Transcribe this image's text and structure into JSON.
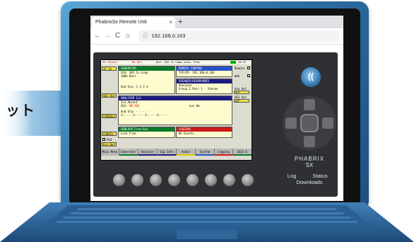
{
  "banner_text": "ット",
  "browser": {
    "tab_title": "PhabrixSx Remote Unit",
    "tab_close": "×",
    "new_tab": "+",
    "back": "←",
    "forward": "→",
    "reload": "C",
    "home": "⌂",
    "info_icon": "ⓘ",
    "url": "192.168.0.163"
  },
  "device": {
    "status_bar": {
      "in_label": "In:",
      "in_value": "Absent",
      "aes_value": "NO AES",
      "output": "Out: SDI In Loop  Lock:   Free",
      "time": "10:47"
    },
    "left_buttons": [
      "1F In",
      "SDI Out",
      "CVBSOut",
      "CVBSIn",
      "Ext.Ref"
    ],
    "psu_label": "PSU",
    "generator": {
      "title": "GENERATOR",
      "line1": "Std: SDI In Loop",
      "line2": "100% Bars",
      "line3": "Aud Grp:  1 2 3 4"
    },
    "remote_control": {
      "title": "REMOTE CONTROL",
      "line1": "TCP/IP: 192.168.0.163"
    },
    "speaker": {
      "title": "SPEAKER/HEADPHONES",
      "line1": "Analyser",
      "line2": "Group 1 Pair 1 - Stereo"
    },
    "right_labels": {
      "remote": "Remote",
      "web": "Web",
      "ana_out": "Ana Out",
      "ana_out_value": "OFF",
      "aes_out": "AES Out",
      "aes_out_value": "OFF"
    },
    "analyser": {
      "title": "ANALYSER    In1",
      "line1": "In1 Absent",
      "line2_label": "AES:",
      "line2_value": "NO AES",
      "len": "Len 0m",
      "line3": "Aud Grp:  - - - -",
      "line4": "1:----  2:----  3:----  4:----"
    },
    "genlock": {
      "title": "GENLOCK    Free-Run",
      "line1": "Lock   Free"
    },
    "logging": {
      "title": "LOGGING",
      "line1": "No Events"
    },
    "menu": [
      "Main Menu",
      "Generator",
      "Analyser",
      "Sig Info",
      "Audio",
      "System",
      "Logging",
      "2022-6"
    ],
    "brand_line1": "PHABRIX",
    "brand_line2": "SX",
    "link_log": "Log",
    "link_status": "Status",
    "link_downloads": "Downloads",
    "logo_glyph": "((",
    "knob_count": 8
  },
  "colors": {
    "laptop_blue": "#2d6ea4",
    "arrow_blue": "#6aa9d6",
    "lcd_yellow_panel": "#fdfccf",
    "header_green": "#0a7a2a",
    "header_blue": "#2a50c8",
    "header_navy": "#1c1c80",
    "header_red": "#cc1a1a",
    "button_yellow": "#f2e04a"
  }
}
